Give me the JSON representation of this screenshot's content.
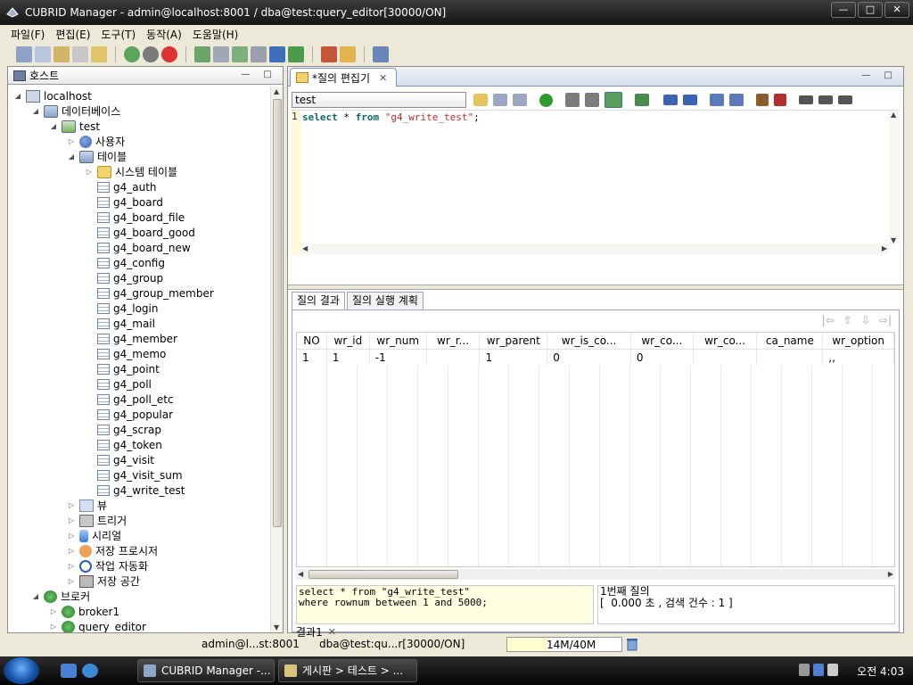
{
  "window": {
    "title": "CUBRID Manager - admin@localhost:8001 / dba@test:query_editor[30000/ON]",
    "controls": {
      "minimize": "—",
      "maximize": "□",
      "close": "✕"
    }
  },
  "menubar": {
    "items": [
      "파일(F)",
      "편집(E)",
      "도구(T)",
      "동작(A)",
      "도움말(H)"
    ]
  },
  "host_panel": {
    "tab_label": "호스트",
    "tree": {
      "localhost": "localhost",
      "databases": "데이터베이스",
      "test": "test",
      "users": "사용자",
      "tables": "테이블",
      "system_tables": "시스템 테이블",
      "table_items": [
        "g4_auth",
        "g4_board",
        "g4_board_file",
        "g4_board_good",
        "g4_board_new",
        "g4_config",
        "g4_group",
        "g4_group_member",
        "g4_login",
        "g4_mail",
        "g4_member",
        "g4_memo",
        "g4_point",
        "g4_poll",
        "g4_poll_etc",
        "g4_popular",
        "g4_scrap",
        "g4_token",
        "g4_visit",
        "g4_visit_sum",
        "g4_write_test"
      ],
      "views": "뷰",
      "triggers": "트리거",
      "serials": "시리얼",
      "procedures": "저장 프로시저",
      "jobs": "작업 자동화",
      "storage": "저장 공간",
      "broker": "브로커",
      "broker1": "broker1",
      "query_editor": "query_editor"
    }
  },
  "editor": {
    "tab_label": "*질의 편집기",
    "database_select": "test",
    "line_number": "1",
    "code": {
      "kw1": "select",
      "star": " * ",
      "kw2": "from",
      "str": "\"g4_write_test\"",
      "end": ";"
    }
  },
  "results": {
    "tabs": [
      "질의 결과",
      "질의 실행 계획"
    ],
    "columns": [
      "NO",
      "wr_id",
      "wr_num",
      "wr_r...",
      "wr_parent",
      "wr_is_co...",
      "wr_co...",
      "wr_co...",
      "ca_name",
      "wr_option"
    ],
    "rows": [
      [
        "1",
        "1",
        "-1",
        "",
        "1",
        "0",
        "0",
        "",
        "",
        ",,"
      ]
    ],
    "sql_log": [
      "select * from \"g4_write_test\"",
      "where rownum between 1 and 5000;"
    ],
    "message": [
      "1번째 질의",
      "[  0.000 초 , 검색 건수 : 1 ]"
    ],
    "bottom_tab": "결과1"
  },
  "statusbar": {
    "host": "admin@l...st:8001",
    "db": "dba@test:qu...r[30000/ON]",
    "memory": "14M/40M",
    "memory_usage_fraction": 0.35
  },
  "taskbar": {
    "tasks": [
      "CUBRID Manager -...",
      "게시판 > 테스트 > ..."
    ],
    "clock": "오전 4:03"
  }
}
